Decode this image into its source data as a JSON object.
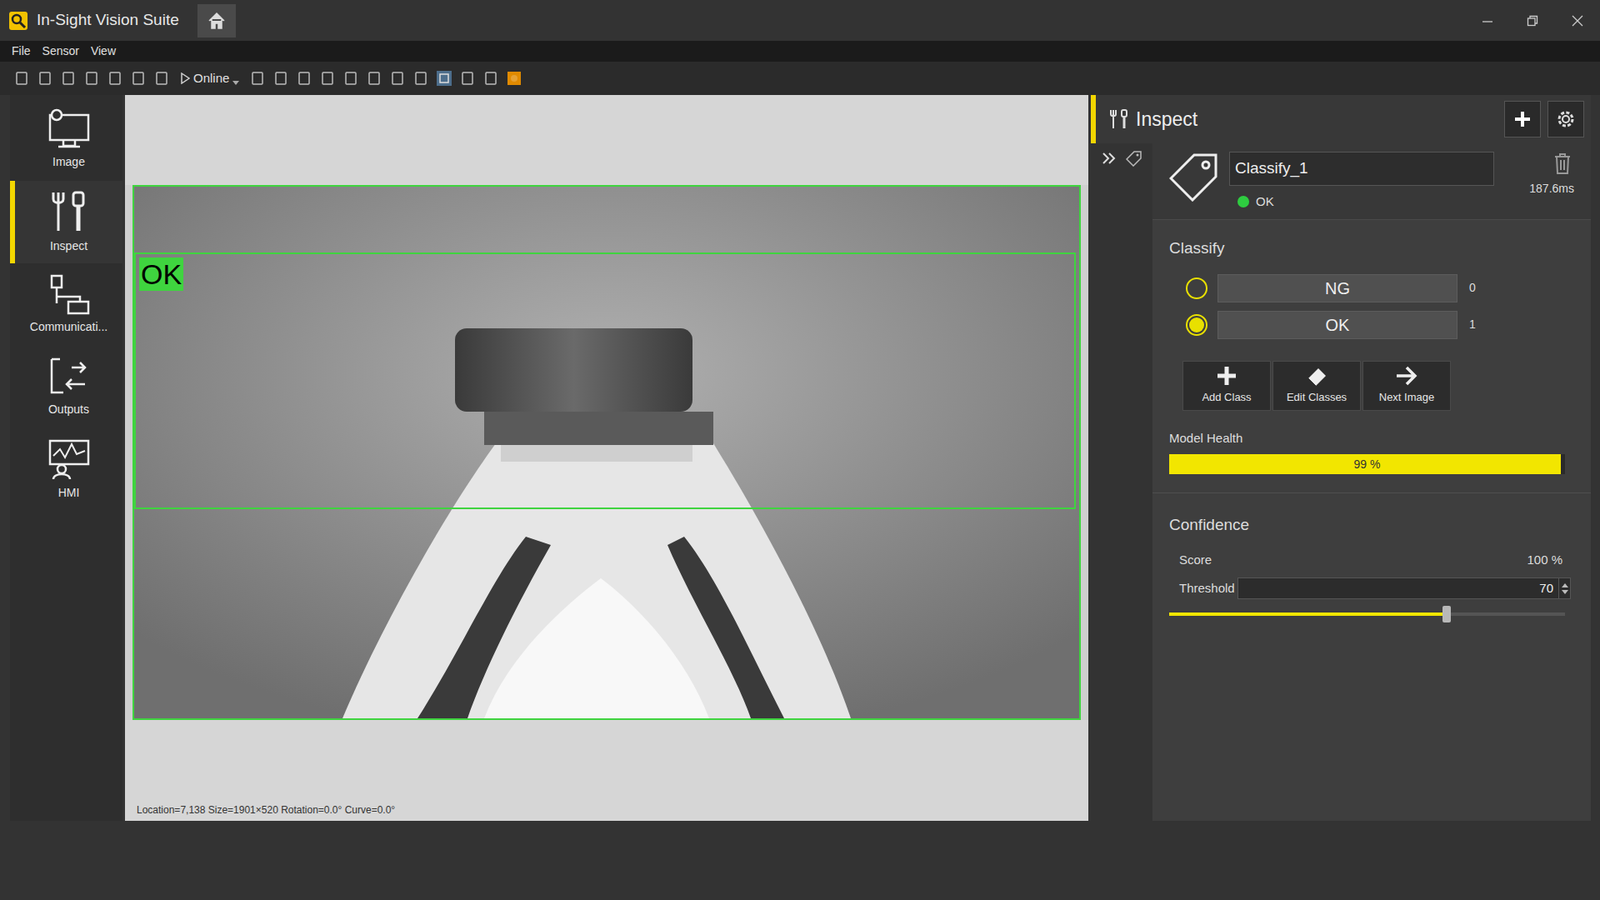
{
  "window": {
    "title": "In-Sight Vision Suite"
  },
  "menu": [
    "File",
    "Sensor",
    "View"
  ],
  "toolbar": {
    "online": "Online"
  },
  "nav": [
    {
      "label": "Image",
      "selected": false
    },
    {
      "label": "Inspect",
      "selected": true
    },
    {
      "label": "Communicati...",
      "selected": false
    },
    {
      "label": "Outputs",
      "selected": false
    },
    {
      "label": "HMI",
      "selected": false
    }
  ],
  "canvas": {
    "result_label": "OK",
    "status": "Location=7,138 Size=1901×520 Rotation=0.0° Curve=0.0°"
  },
  "panel": {
    "title": "Inspect",
    "tool": {
      "name": "Classify_1",
      "status": "OK",
      "ok": true,
      "time": "187.6ms"
    },
    "classify": {
      "title": "Classify",
      "classes": [
        {
          "name": "NG",
          "count": "0",
          "selected": false
        },
        {
          "name": "OK",
          "count": "1",
          "selected": true
        }
      ],
      "buttons": [
        "Add Class",
        "Edit Classes",
        "Next Image"
      ]
    },
    "model_health": {
      "label": "Model Health",
      "reading": "99 %",
      "level": 0.99
    },
    "confidence": {
      "title": "Confidence",
      "score_label": "Score",
      "score": "100 %",
      "threshold_label": "Threshold",
      "threshold": "70",
      "level": 0.7
    }
  }
}
